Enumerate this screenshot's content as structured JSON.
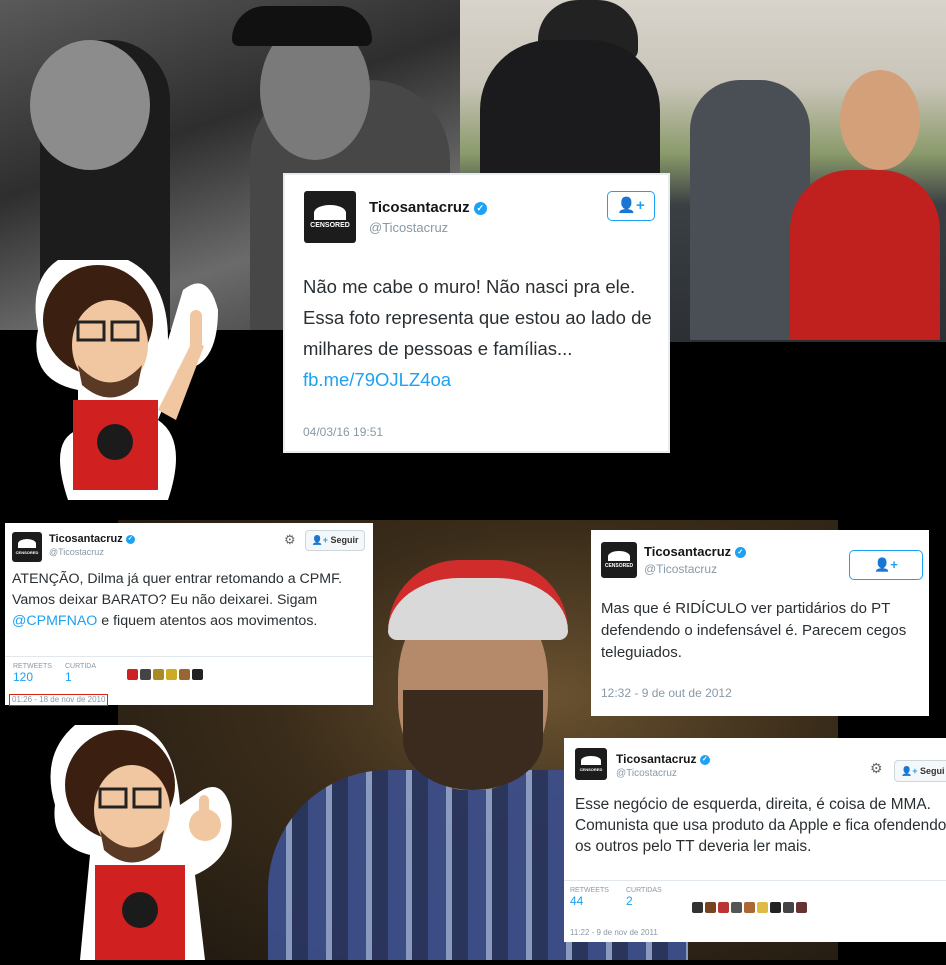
{
  "tweet_main": {
    "name": "Ticosantacruz",
    "handle": "@Ticostacruz",
    "avatar_label": "CENSORED",
    "text_line1": "Não me cabe o muro! Não nasci pra ele.",
    "text_line2": "Essa foto representa que estou ao lado de milhares de pessoas e famílias...",
    "link": "fb.me/79OJLZ4oa",
    "timestamp": "04/03/16 19:51"
  },
  "tweet_cpmf": {
    "name": "Ticosantacruz",
    "handle": "@Ticostacruz",
    "follow_label": "Seguir",
    "text_before": "ATENÇÃO, Dilma já quer entrar retomando a CPMF. Vamos deixar BARATO? Eu não deixarei. Sigam ",
    "mention": "@CPMFNAO",
    "text_after": " e fiquem atentos aos movimentos.",
    "retweets_label": "RETWEETS",
    "retweets_value": "120",
    "likes_label": "CURTIDA",
    "likes_value": "1",
    "timestamp": "01:26 - 18 de nov de 2010"
  },
  "tweet_ridiculo": {
    "name": "Ticosantacruz",
    "handle": "@Ticostacruz",
    "text": "Mas que é RIDÍCULO ver partidários do PT defendendo o indefensável é. Parecem cegos teleguiados.",
    "timestamp": "12:32 - 9 de out de 2012"
  },
  "tweet_mma": {
    "name": "Ticosantacruz",
    "handle": "@Ticostacruz",
    "follow_label": "Segui",
    "text": "Esse negócio de esquerda, direita, é coisa de MMA. Comunista que usa produto da Apple e fica ofendendo os outros pelo TT deveria ler mais.",
    "retweets_label": "RETWEETS",
    "retweets_value": "44",
    "likes_label": "CURTIDAS",
    "likes_value": "2",
    "timestamp": "11:22 - 9 de nov de 2011"
  },
  "colors": {
    "twitter_blue": "#1da1f2",
    "background": "#000000",
    "che_shirt": "#d0201f"
  },
  "icons": [
    "add-user-icon",
    "gear-icon",
    "verified-badge-icon",
    "censored-avatar-icon"
  ]
}
